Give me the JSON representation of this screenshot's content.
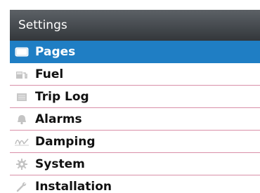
{
  "header": {
    "title": "Settings"
  },
  "menu": {
    "items": [
      {
        "label": "Pages",
        "icon": "pages-icon",
        "selected": true
      },
      {
        "label": "Fuel",
        "icon": "fuel-icon",
        "selected": false
      },
      {
        "label": "Trip Log",
        "icon": "trip-log-icon",
        "selected": false
      },
      {
        "label": "Alarms",
        "icon": "bell-icon",
        "selected": false
      },
      {
        "label": "Damping",
        "icon": "damping-icon",
        "selected": false
      },
      {
        "label": "System",
        "icon": "gear-icon",
        "selected": false
      },
      {
        "label": "Installation",
        "icon": "wrench-icon",
        "selected": false
      }
    ]
  },
  "colors": {
    "header_bg": "#3d4145",
    "selected_bg": "#1f7ec4",
    "divider": "#d98fa8",
    "icon_gray": "#b8b8b8"
  }
}
